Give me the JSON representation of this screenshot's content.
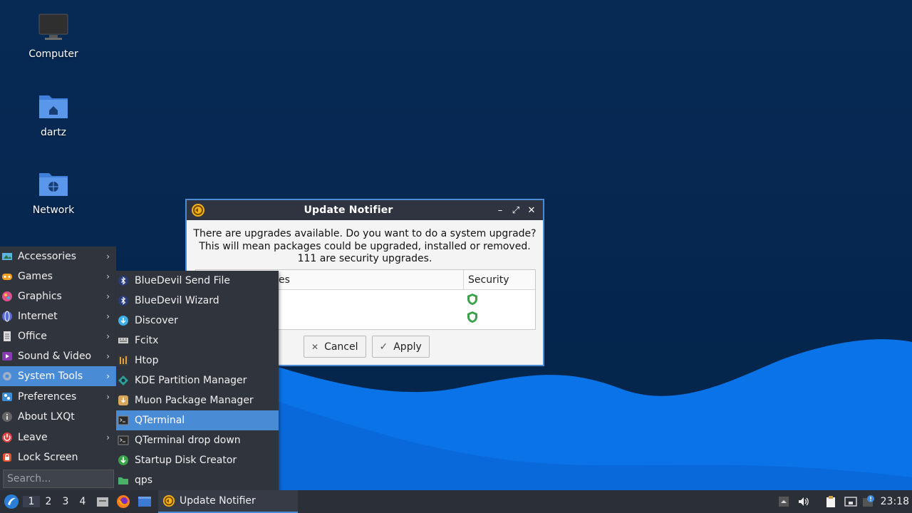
{
  "desktop": {
    "icons": [
      {
        "label": "Computer"
      },
      {
        "label": "dartz"
      },
      {
        "label": "Network"
      }
    ]
  },
  "dialog": {
    "title": "Update Notifier",
    "message_lines": [
      "There are upgrades available. Do you want to do a system upgrade?",
      "This will mean packages could be upgraded, installed or removed.",
      "111 are security upgrades."
    ],
    "table": {
      "col1_header_partial": "es",
      "col2_header": "Security"
    },
    "buttons": {
      "cancel": "Cancel",
      "apply": "Apply"
    }
  },
  "main_menu": {
    "items": [
      {
        "label": "Accessories",
        "icon": "accessories-icon"
      },
      {
        "label": "Games",
        "icon": "games-icon"
      },
      {
        "label": "Graphics",
        "icon": "graphics-icon"
      },
      {
        "label": "Internet",
        "icon": "internet-icon"
      },
      {
        "label": "Office",
        "icon": "office-icon"
      },
      {
        "label": "Sound & Video",
        "icon": "sound-video-icon"
      },
      {
        "label": "System Tools",
        "icon": "system-tools-icon"
      },
      {
        "label": "Preferences",
        "icon": "preferences-icon"
      },
      {
        "label": "About LXQt",
        "icon": "about-icon"
      },
      {
        "label": "Leave",
        "icon": "power-icon"
      },
      {
        "label": "Lock Screen",
        "icon": "lock-icon"
      }
    ],
    "search_placeholder": "Search..."
  },
  "sub_menu": {
    "items": [
      {
        "label": "BlueDevil Send File"
      },
      {
        "label": "BlueDevil Wizard"
      },
      {
        "label": "Discover"
      },
      {
        "label": "Fcitx"
      },
      {
        "label": "Htop"
      },
      {
        "label": "KDE Partition Manager"
      },
      {
        "label": "Muon Package Manager"
      },
      {
        "label": "QTerminal"
      },
      {
        "label": "QTerminal drop down"
      },
      {
        "label": "Startup Disk Creator"
      },
      {
        "label": "qps"
      }
    ]
  },
  "taskbar": {
    "workspaces": [
      "1",
      "2",
      "3",
      "4"
    ],
    "task_label": "Update Notifier",
    "clock": "23:18"
  },
  "colors": {
    "accent": "#4a8bd6",
    "menu_bg": "#30343d",
    "taskbar_bg": "#2b2f37",
    "security_shield": "#3aa34a"
  }
}
